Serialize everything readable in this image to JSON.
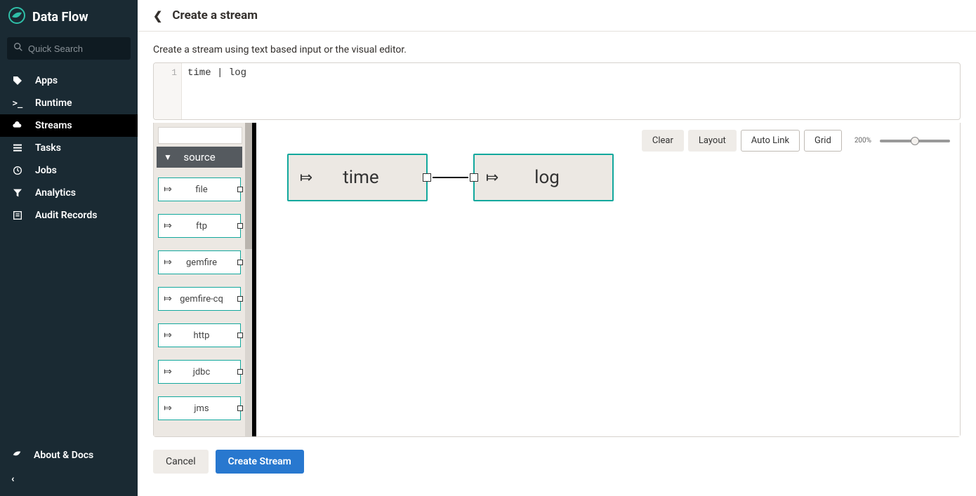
{
  "brand": {
    "title": "Data Flow"
  },
  "search": {
    "placeholder": "Quick Search"
  },
  "nav": {
    "items": [
      {
        "label": "Apps",
        "icon": "tag-icon"
      },
      {
        "label": "Runtime",
        "icon": "terminal-icon"
      },
      {
        "label": "Streams",
        "icon": "cloud-icon",
        "active": true
      },
      {
        "label": "Tasks",
        "icon": "list-icon"
      },
      {
        "label": "Jobs",
        "icon": "clock-icon"
      },
      {
        "label": "Analytics",
        "icon": "filter-icon"
      },
      {
        "label": "Audit Records",
        "icon": "records-icon"
      }
    ]
  },
  "footer_nav": {
    "items": [
      {
        "label": "About & Docs",
        "icon": "leaf-icon"
      }
    ]
  },
  "header": {
    "title": "Create a stream"
  },
  "subhead": "Create a stream using text based input or the visual editor.",
  "code": {
    "line_no": "1",
    "text": "time | log"
  },
  "palette": {
    "group_label": "source",
    "items": [
      {
        "label": "file"
      },
      {
        "label": "ftp"
      },
      {
        "label": "gemfire"
      },
      {
        "label": "gemfire-cq"
      },
      {
        "label": "http"
      },
      {
        "label": "jdbc"
      },
      {
        "label": "jms"
      }
    ]
  },
  "toolbar": {
    "clear": "Clear",
    "layout": "Layout",
    "autolink": "Auto Link",
    "grid": "Grid",
    "zoom": "200%"
  },
  "flow": {
    "nodes": [
      {
        "label": "time"
      },
      {
        "label": "log"
      }
    ]
  },
  "actions": {
    "cancel": "Cancel",
    "create": "Create Stream"
  }
}
